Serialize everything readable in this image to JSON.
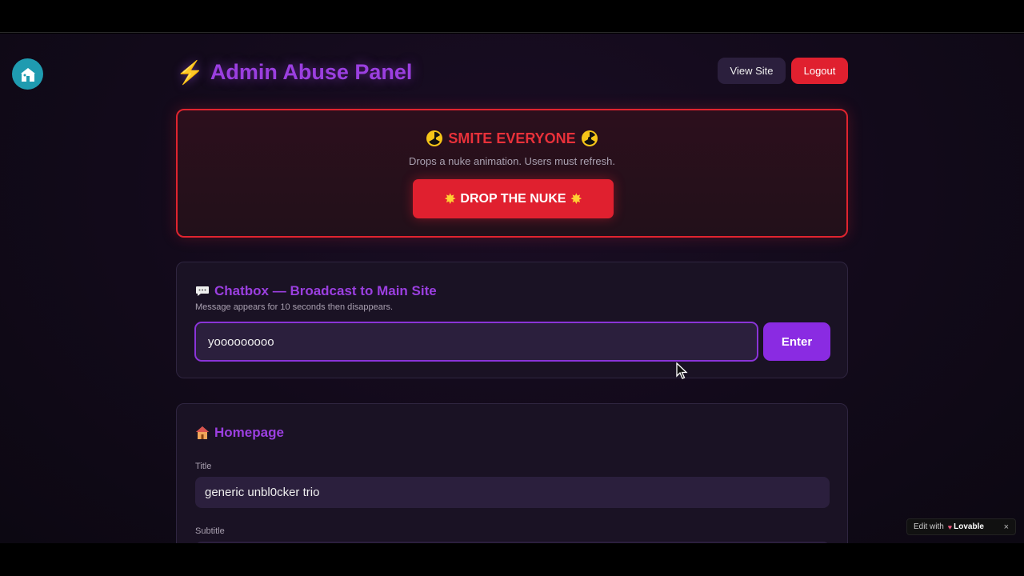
{
  "header": {
    "title": "Admin Abuse Panel",
    "bolt_icon": "lightning-bolt-icon",
    "view_site_label": "View Site",
    "logout_label": "Logout"
  },
  "nuke": {
    "title": "SMITE EVERYONE",
    "description": "Drops a nuke animation. Users must refresh.",
    "button_label": "DROP THE NUKE",
    "icons": [
      "radioactive-icon",
      "collision-icon"
    ]
  },
  "chatbox": {
    "heading": "Chatbox — Broadcast to Main Site",
    "hint": "Message appears for 10 seconds then disappears.",
    "input_value": "yooooooooo",
    "enter_label": "Enter",
    "icon": "speech-bubble-icon"
  },
  "homepage": {
    "heading": "Homepage",
    "icon": "house-icon",
    "title_label": "Title",
    "title_value": "generic unbl0cker trio",
    "subtitle_label": "Subtitle",
    "subtitle_value": ""
  },
  "lovable_badge": {
    "prefix": "Edit with",
    "brand": "Lovable",
    "close": "×"
  },
  "colors": {
    "accent_purple": "#9b3fe0",
    "danger_red": "#e0202f",
    "background": "#120a1a",
    "card": "#1a1224"
  }
}
